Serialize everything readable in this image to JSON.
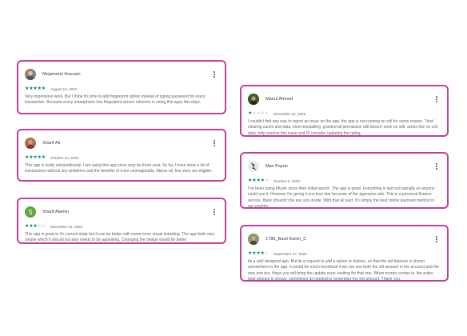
{
  "colors": {
    "accent_border": "#c2409a",
    "star_filled": "#01875f",
    "star_empty": "#dadce0"
  },
  "reviews": [
    {
      "name": "Mojammel Hossain",
      "rating": 5,
      "date": "August 16, 2022",
      "avatar": {
        "type": "photo",
        "bg": "#8d8177"
      },
      "text": "Very impressive work. But I think it's time to add fingerprint option instead of typing password for every transaction. Because every smartphone has fingerprint sensor whoever is using this apps this days."
    },
    {
      "name": "Sharif Ali",
      "rating": 5,
      "date": "October 10, 2022",
      "avatar": {
        "type": "photo",
        "bg": "#b06e55"
      },
      "text": "This app is really extraordinarily. I am using this app since may be three year. So far, I have done a lot of transactions without any problems and the benefits of it are unimaginable. Above all, five stars are eligible."
    },
    {
      "name": "Sharif Alamin",
      "rating": 3,
      "date": "December 31, 2022",
      "avatar": {
        "type": "letter",
        "letter": "S",
        "bg": "#5fa63d"
      },
      "text": "This app is great in it's current state but it can be better with some more visual tweeking. The app feels very simple which it should but also needs to be appealing. Changing the design would be better"
    },
    {
      "name": "Manul Ahmed",
      "rating": 1,
      "date": "November 16, 2022",
      "avatar": {
        "type": "photo",
        "bg": "#2f3f2a"
      },
      "text": "I couldn't find any way to report an issue on the app. the app is not running on wifi for some reason. Tried clearing cache and data, tried reinstalling, granted all permission still doesn't work on wifi. works fine on cell data. help resolve this issue and I'll consider updating the rating."
    },
    {
      "name": "Max Payne",
      "rating": 4,
      "date": "October 6, 2022",
      "avatar": {
        "type": "photo",
        "bg": "#e8e8e8"
      },
      "text": "I've been using bKash since their initial launch. The app is great. Everything is laid out logically so anyone could use it. However I'm giving it one less star because of the agressive ads. This is a personal finance service, there shouldn't be any ads inside. With that all said, it's simply the best online payment method in our country."
    },
    {
      "name": "1788_Basit Karim_C",
      "rating": 4,
      "date": "September 17, 2022",
      "avatar": {
        "type": "photo",
        "bg": "#6f7a57"
      },
      "text": "Its a well designed app. But its a request to add a option or feature, so that the old balance is shown somewhere in the app. It would be much beneficial if we can see both the old amount in the account and the new one too. Hope you will bring the update soon, waiting for that one. When money comes in, the entire total amount is shown, sometimes its needed to remember the old amount. Thank you."
    }
  ]
}
